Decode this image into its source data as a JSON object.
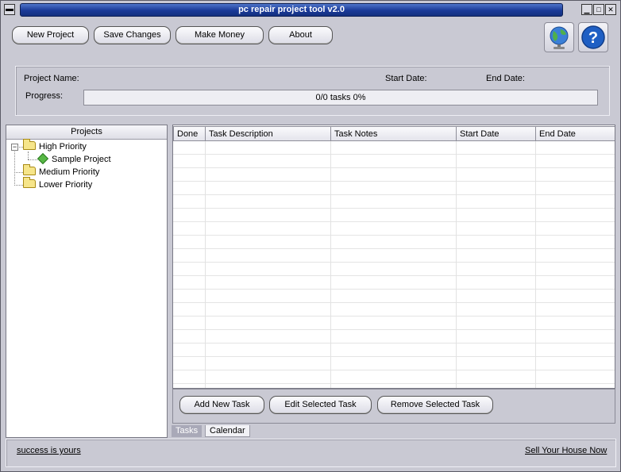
{
  "window": {
    "title": "pc repair project tool v2.0",
    "sys_menu_glyph": "▬",
    "minimize_glyph": "▁",
    "maximize_glyph": "□",
    "close_glyph": "✕"
  },
  "toolbar": {
    "new_project": "New Project",
    "save_changes": "Save Changes",
    "make_money": "Make Money",
    "about": "About",
    "globe_icon": "globe-icon",
    "help_icon": "help-icon",
    "help_glyph": "?"
  },
  "project_info": {
    "name_label": "Project Name:",
    "start_label": "Start Date:",
    "end_label": "End Date:",
    "progress_label": "Progress:",
    "progress_text": "0/0 tasks  0%",
    "progress_fraction": 0
  },
  "projects": {
    "header": "Projects",
    "expander": "−",
    "items": [
      {
        "label": "High Priority",
        "children": [
          "Sample Project"
        ]
      },
      {
        "label": "Medium Priority"
      },
      {
        "label": "Lower Priority"
      }
    ]
  },
  "tasks_table": {
    "columns": [
      "Done",
      "Task Description",
      "Task Notes",
      "Start Date",
      "End Date"
    ],
    "rows": []
  },
  "task_buttons": {
    "add": "Add New Task",
    "edit": "Edit Selected Task",
    "remove": "Remove Selected Task"
  },
  "tabs": [
    "Tasks",
    "Calendar"
  ],
  "footer": {
    "left_link": "success is yours",
    "right_link": "Sell Your House Now"
  },
  "colors": {
    "title_bar": "#1a3a98",
    "window_bg": "#c9c9d3",
    "active_tab_text": "#ffffff"
  }
}
